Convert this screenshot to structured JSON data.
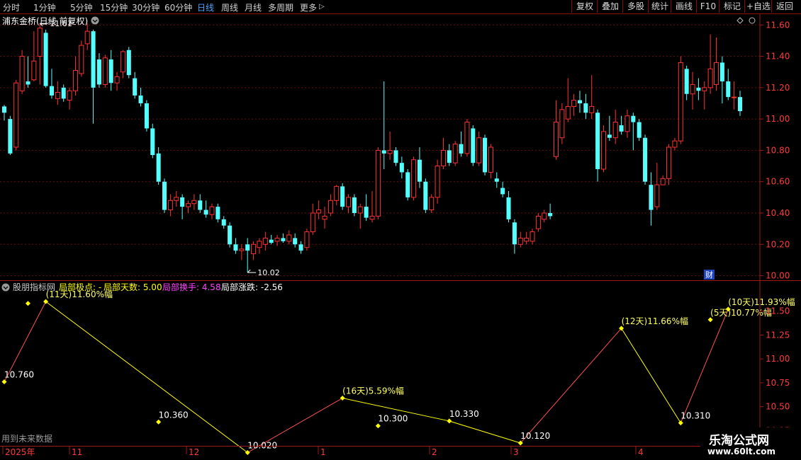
{
  "toolbar": {
    "periods": [
      "分时",
      "1分钟",
      "5分钟",
      "15分钟",
      "30分钟",
      "60分钟",
      "日线",
      "周线",
      "月线",
      "多周期",
      "更多"
    ],
    "active_period": "日线",
    "buttons": [
      "复权",
      "叠加",
      "多股",
      "统计",
      "画线",
      "F10",
      "标记",
      "+自选",
      "返回"
    ]
  },
  "main_panel": {
    "title": "浦东金桥(日线 前复权)",
    "high_label": "11.61",
    "low_label": "10.02",
    "cai_badge": "财",
    "y_ticks": [
      "11.60",
      "11.40",
      "11.20",
      "11.00",
      "10.80",
      "10.60",
      "10.40",
      "10.20",
      "10.00"
    ]
  },
  "indicator_panel": {
    "name": "股朋指标网",
    "items": [
      {
        "label": "局部极点: -",
        "color": "#ffff00"
      },
      {
        "label": "局部天数: 5.00",
        "color": "#ffff00"
      },
      {
        "label": "局部换手: 4.58",
        "color": "#ff44ff"
      },
      {
        "label": "局部涨跌: -2.56",
        "color": "#ffffff"
      }
    ],
    "y_ticks": [
      "11.50",
      "11.25",
      "11.00",
      "10.75",
      "10.50",
      "10.25"
    ],
    "footer_text": "用到未来数据"
  },
  "x_axis": {
    "labels": [
      "2025年",
      "11",
      "12",
      "1",
      "2",
      "3",
      "4"
    ]
  },
  "watermark": {
    "line1": "乐淘公式网",
    "line2": "www.60lt.com"
  },
  "chart_data": {
    "type": "candlestick",
    "title": "浦东金桥(日线 前复权)",
    "ylim": [
      9.98,
      11.66
    ],
    "up_color": "#ff3232",
    "down_color": "#54ffff",
    "candles": [
      {
        "o": 11.08,
        "h": 11.09,
        "l": 10.99,
        "c": 11.04
      },
      {
        "o": 11.0,
        "h": 11.02,
        "l": 10.77,
        "c": 10.78
      },
      {
        "o": 10.82,
        "h": 11.25,
        "l": 10.8,
        "c": 11.23
      },
      {
        "o": 11.18,
        "h": 11.44,
        "l": 11.16,
        "c": 11.4
      },
      {
        "o": 11.24,
        "h": 11.4,
        "l": 11.2,
        "c": 11.22
      },
      {
        "o": 11.25,
        "h": 11.56,
        "l": 11.24,
        "c": 11.37
      },
      {
        "o": 11.4,
        "h": 11.61,
        "l": 11.22,
        "c": 11.58
      },
      {
        "o": 11.55,
        "h": 11.57,
        "l": 11.2,
        "c": 11.21
      },
      {
        "o": 11.21,
        "h": 11.32,
        "l": 11.13,
        "c": 11.15
      },
      {
        "o": 11.13,
        "h": 11.24,
        "l": 11.09,
        "c": 11.17
      },
      {
        "o": 11.2,
        "h": 11.22,
        "l": 11.11,
        "c": 11.13
      },
      {
        "o": 11.12,
        "h": 11.2,
        "l": 11.06,
        "c": 11.18
      },
      {
        "o": 11.18,
        "h": 11.4,
        "l": 11.15,
        "c": 11.31
      },
      {
        "o": 11.29,
        "h": 11.5,
        "l": 11.27,
        "c": 11.47
      },
      {
        "o": 11.48,
        "h": 11.61,
        "l": 11.44,
        "c": 11.56
      },
      {
        "o": 11.56,
        "h": 11.57,
        "l": 10.97,
        "c": 11.2
      },
      {
        "o": 11.38,
        "h": 11.42,
        "l": 11.2,
        "c": 11.22
      },
      {
        "o": 11.22,
        "h": 11.41,
        "l": 11.2,
        "c": 11.39
      },
      {
        "o": 11.38,
        "h": 11.44,
        "l": 11.18,
        "c": 11.23
      },
      {
        "o": 11.23,
        "h": 11.3,
        "l": 11.18,
        "c": 11.27
      },
      {
        "o": 11.3,
        "h": 11.44,
        "l": 11.26,
        "c": 11.43
      },
      {
        "o": 11.44,
        "h": 11.46,
        "l": 11.26,
        "c": 11.28
      },
      {
        "o": 11.26,
        "h": 11.3,
        "l": 11.13,
        "c": 11.15
      },
      {
        "o": 11.15,
        "h": 11.2,
        "l": 11.08,
        "c": 11.1
      },
      {
        "o": 11.1,
        "h": 11.12,
        "l": 10.92,
        "c": 10.94
      },
      {
        "o": 10.94,
        "h": 10.97,
        "l": 10.75,
        "c": 10.77
      },
      {
        "o": 10.78,
        "h": 10.82,
        "l": 10.58,
        "c": 10.6
      },
      {
        "o": 10.6,
        "h": 10.62,
        "l": 10.4,
        "c": 10.42
      },
      {
        "o": 10.42,
        "h": 10.52,
        "l": 10.38,
        "c": 10.48
      },
      {
        "o": 10.48,
        "h": 10.54,
        "l": 10.44,
        "c": 10.5
      },
      {
        "o": 10.5,
        "h": 10.52,
        "l": 10.36,
        "c": 10.44
      },
      {
        "o": 10.44,
        "h": 10.48,
        "l": 10.4,
        "c": 10.46
      },
      {
        "o": 10.46,
        "h": 10.52,
        "l": 10.42,
        "c": 10.48
      },
      {
        "o": 10.48,
        "h": 10.52,
        "l": 10.4,
        "c": 10.42
      },
      {
        "o": 10.42,
        "h": 10.48,
        "l": 10.37,
        "c": 10.39
      },
      {
        "o": 10.39,
        "h": 10.46,
        "l": 10.36,
        "c": 10.44
      },
      {
        "o": 10.44,
        "h": 10.46,
        "l": 10.34,
        "c": 10.36
      },
      {
        "o": 10.36,
        "h": 10.38,
        "l": 10.3,
        "c": 10.32
      },
      {
        "o": 10.32,
        "h": 10.34,
        "l": 10.18,
        "c": 10.2
      },
      {
        "o": 10.2,
        "h": 10.24,
        "l": 10.14,
        "c": 10.16
      },
      {
        "o": 10.16,
        "h": 10.2,
        "l": 10.1,
        "c": 10.17
      },
      {
        "o": 10.2,
        "h": 10.24,
        "l": 10.02,
        "c": 10.16
      },
      {
        "o": 10.14,
        "h": 10.22,
        "l": 10.1,
        "c": 10.2
      },
      {
        "o": 10.18,
        "h": 10.24,
        "l": 10.14,
        "c": 10.22
      },
      {
        "o": 10.2,
        "h": 10.28,
        "l": 10.16,
        "c": 10.24
      },
      {
        "o": 10.23,
        "h": 10.26,
        "l": 10.2,
        "c": 10.21
      },
      {
        "o": 10.22,
        "h": 10.26,
        "l": 10.19,
        "c": 10.24
      },
      {
        "o": 10.24,
        "h": 10.27,
        "l": 10.21,
        "c": 10.22
      },
      {
        "o": 10.22,
        "h": 10.29,
        "l": 10.2,
        "c": 10.26
      },
      {
        "o": 10.24,
        "h": 10.27,
        "l": 10.18,
        "c": 10.2
      },
      {
        "o": 10.2,
        "h": 10.22,
        "l": 10.14,
        "c": 10.16
      },
      {
        "o": 10.18,
        "h": 10.3,
        "l": 10.16,
        "c": 10.28
      },
      {
        "o": 10.28,
        "h": 10.46,
        "l": 10.26,
        "c": 10.4
      },
      {
        "o": 10.4,
        "h": 10.48,
        "l": 10.36,
        "c": 10.42
      },
      {
        "o": 10.36,
        "h": 10.44,
        "l": 10.3,
        "c": 10.38
      },
      {
        "o": 10.4,
        "h": 10.52,
        "l": 10.38,
        "c": 10.48
      },
      {
        "o": 10.48,
        "h": 10.58,
        "l": 10.45,
        "c": 10.57
      },
      {
        "o": 10.57,
        "h": 10.59,
        "l": 10.42,
        "c": 10.44
      },
      {
        "o": 10.44,
        "h": 10.52,
        "l": 10.4,
        "c": 10.5
      },
      {
        "o": 10.5,
        "h": 10.52,
        "l": 10.38,
        "c": 10.4
      },
      {
        "o": 10.4,
        "h": 10.46,
        "l": 10.3,
        "c": 10.44
      },
      {
        "o": 10.44,
        "h": 10.52,
        "l": 10.35,
        "c": 10.37
      },
      {
        "o": 10.36,
        "h": 10.54,
        "l": 10.34,
        "c": 10.38
      },
      {
        "o": 10.38,
        "h": 10.82,
        "l": 10.36,
        "c": 10.8
      },
      {
        "o": 10.8,
        "h": 11.24,
        "l": 10.68,
        "c": 10.78
      },
      {
        "o": 10.78,
        "h": 10.92,
        "l": 10.74,
        "c": 10.8
      },
      {
        "o": 10.8,
        "h": 10.82,
        "l": 10.7,
        "c": 10.72
      },
      {
        "o": 10.72,
        "h": 10.76,
        "l": 10.62,
        "c": 10.66
      },
      {
        "o": 10.66,
        "h": 10.68,
        "l": 10.48,
        "c": 10.5
      },
      {
        "o": 10.5,
        "h": 10.76,
        "l": 10.48,
        "c": 10.74
      },
      {
        "o": 10.74,
        "h": 10.82,
        "l": 10.56,
        "c": 10.6
      },
      {
        "o": 10.6,
        "h": 10.62,
        "l": 10.4,
        "c": 10.42
      },
      {
        "o": 10.42,
        "h": 10.52,
        "l": 10.4,
        "c": 10.5
      },
      {
        "o": 10.5,
        "h": 10.74,
        "l": 10.46,
        "c": 10.7
      },
      {
        "o": 10.7,
        "h": 10.88,
        "l": 10.68,
        "c": 10.8
      },
      {
        "o": 10.8,
        "h": 10.84,
        "l": 10.7,
        "c": 10.72
      },
      {
        "o": 10.72,
        "h": 10.86,
        "l": 10.7,
        "c": 10.84
      },
      {
        "o": 10.84,
        "h": 10.92,
        "l": 10.76,
        "c": 10.78
      },
      {
        "o": 10.78,
        "h": 11.0,
        "l": 10.76,
        "c": 10.98
      },
      {
        "o": 10.94,
        "h": 10.96,
        "l": 10.7,
        "c": 10.72
      },
      {
        "o": 10.72,
        "h": 10.92,
        "l": 10.7,
        "c": 10.88
      },
      {
        "o": 10.88,
        "h": 10.9,
        "l": 10.64,
        "c": 10.66
      },
      {
        "o": 10.66,
        "h": 10.84,
        "l": 10.62,
        "c": 10.82
      },
      {
        "o": 10.62,
        "h": 10.66,
        "l": 10.56,
        "c": 10.6
      },
      {
        "o": 10.56,
        "h": 10.6,
        "l": 10.5,
        "c": 10.52
      },
      {
        "o": 10.5,
        "h": 10.54,
        "l": 10.34,
        "c": 10.36
      },
      {
        "o": 10.34,
        "h": 10.36,
        "l": 10.14,
        "c": 10.2
      },
      {
        "o": 10.2,
        "h": 10.28,
        "l": 10.18,
        "c": 10.24
      },
      {
        "o": 10.22,
        "h": 10.28,
        "l": 10.2,
        "c": 10.24
      },
      {
        "o": 10.22,
        "h": 10.3,
        "l": 10.2,
        "c": 10.28
      },
      {
        "o": 10.3,
        "h": 10.4,
        "l": 10.28,
        "c": 10.38
      },
      {
        "o": 10.36,
        "h": 10.42,
        "l": 10.34,
        "c": 10.4
      },
      {
        "o": 10.4,
        "h": 10.46,
        "l": 10.36,
        "c": 10.38
      },
      {
        "o": 10.76,
        "h": 11.12,
        "l": 10.74,
        "c": 10.98
      },
      {
        "o": 10.88,
        "h": 11.1,
        "l": 10.84,
        "c": 11.06
      },
      {
        "o": 11.0,
        "h": 11.26,
        "l": 10.98,
        "c": 11.08
      },
      {
        "o": 11.08,
        "h": 11.16,
        "l": 11.02,
        "c": 11.12
      },
      {
        "o": 11.12,
        "h": 11.18,
        "l": 11.04,
        "c": 11.1
      },
      {
        "o": 11.1,
        "h": 11.16,
        "l": 11.0,
        "c": 11.04
      },
      {
        "o": 11.04,
        "h": 11.28,
        "l": 11.0,
        "c": 11.08
      },
      {
        "o": 11.04,
        "h": 11.06,
        "l": 10.6,
        "c": 10.68
      },
      {
        "o": 10.68,
        "h": 10.96,
        "l": 10.66,
        "c": 10.92
      },
      {
        "o": 10.9,
        "h": 11.02,
        "l": 10.86,
        "c": 10.88
      },
      {
        "o": 10.88,
        "h": 11.06,
        "l": 10.84,
        "c": 10.98
      },
      {
        "o": 10.96,
        "h": 11.02,
        "l": 10.9,
        "c": 10.92
      },
      {
        "o": 10.92,
        "h": 11.06,
        "l": 10.88,
        "c": 11.02
      },
      {
        "o": 11.02,
        "h": 11.04,
        "l": 10.8,
        "c": 10.98
      },
      {
        "o": 10.98,
        "h": 11.0,
        "l": 10.86,
        "c": 10.88
      },
      {
        "o": 10.88,
        "h": 10.9,
        "l": 10.58,
        "c": 10.6
      },
      {
        "o": 10.58,
        "h": 10.66,
        "l": 10.32,
        "c": 10.42
      },
      {
        "o": 10.44,
        "h": 10.72,
        "l": 10.42,
        "c": 10.58
      },
      {
        "o": 10.58,
        "h": 10.64,
        "l": 10.58,
        "c": 10.62
      },
      {
        "o": 10.62,
        "h": 10.84,
        "l": 10.58,
        "c": 10.82
      },
      {
        "o": 10.82,
        "h": 10.88,
        "l": 10.8,
        "c": 10.86
      },
      {
        "o": 10.86,
        "h": 11.4,
        "l": 10.84,
        "c": 11.36
      },
      {
        "o": 11.32,
        "h": 11.34,
        "l": 11.12,
        "c": 11.16
      },
      {
        "o": 11.16,
        "h": 11.3,
        "l": 11.06,
        "c": 11.22
      },
      {
        "o": 11.2,
        "h": 11.26,
        "l": 11.12,
        "c": 11.18
      },
      {
        "o": 11.18,
        "h": 11.24,
        "l": 11.06,
        "c": 11.2
      },
      {
        "o": 11.2,
        "h": 11.54,
        "l": 11.16,
        "c": 11.32
      },
      {
        "o": 11.22,
        "h": 11.52,
        "l": 11.18,
        "c": 11.36
      },
      {
        "o": 11.36,
        "h": 11.4,
        "l": 11.1,
        "c": 11.24
      },
      {
        "o": 11.24,
        "h": 11.32,
        "l": 11.12,
        "c": 11.14
      },
      {
        "o": 11.14,
        "h": 11.24,
        "l": 11.06,
        "c": 11.14
      },
      {
        "o": 11.14,
        "h": 11.18,
        "l": 11.02,
        "c": 11.05
      }
    ],
    "indicator": {
      "title": "股朋指标网",
      "ylim": [
        10.12,
        11.66
      ],
      "zigzag": [
        {
          "i": 0,
          "v": 10.76,
          "label": "10.760"
        },
        {
          "i": 7,
          "v": 11.6,
          "label": "(11天)11.60%幅"
        },
        {
          "i": 41,
          "v": 10.02,
          "label": "10.020"
        },
        {
          "i": 57,
          "v": 10.59,
          "label": "(16天)5.59%幅"
        },
        {
          "i": 75,
          "v": 10.35,
          "label": "10.330"
        },
        {
          "i": 87,
          "v": 10.12,
          "label": "10.120"
        },
        {
          "i": 104,
          "v": 11.32,
          "label": "(12天)11.66%幅"
        },
        {
          "i": 114,
          "v": 10.33,
          "label": "10.310"
        },
        {
          "i": 122,
          "v": 11.52,
          "label": "(10天)11.93%幅"
        }
      ],
      "extra_points": [
        {
          "i": 4,
          "v": 11.58,
          "label": ""
        },
        {
          "i": 26,
          "v": 10.34,
          "label": "10.360"
        },
        {
          "i": 63,
          "v": 10.3,
          "label": "10.300"
        },
        {
          "i": 119,
          "v": 11.41,
          "label": "(5天)10.77%幅"
        }
      ]
    }
  }
}
